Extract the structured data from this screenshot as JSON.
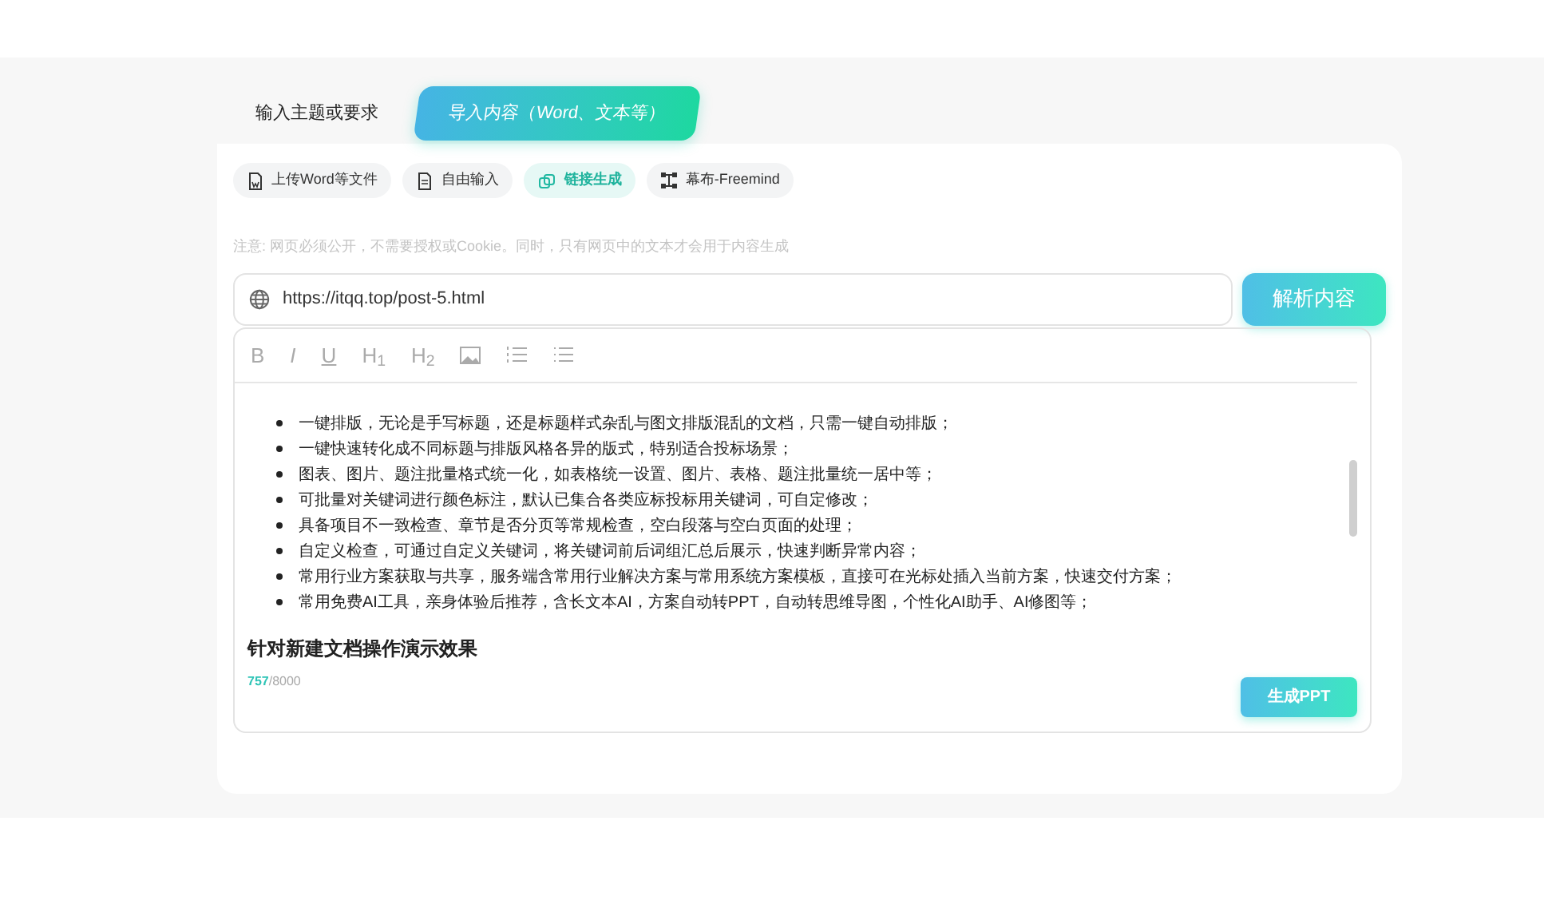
{
  "tabs": [
    {
      "label": "输入主题或要求",
      "selected": false
    },
    {
      "label": "导入内容（Word、文本等）",
      "selected": true
    }
  ],
  "modes": [
    {
      "label": "上传Word等文件",
      "kind": "word",
      "selected": false
    },
    {
      "label": "自由输入",
      "kind": "doc",
      "selected": false
    },
    {
      "label": "链接生成",
      "kind": "link",
      "selected": true
    },
    {
      "label": "幕布-Freemind",
      "kind": "mindmap",
      "selected": false
    }
  ],
  "notice": "注意: 网页必须公开，不需要授权或Cookie。同时，只有网页中的文本才会用于内容生成",
  "url_field": {
    "value": "https://itqq.top/post-5.html"
  },
  "parse_button": "解析内容",
  "toolbar": [
    {
      "kind": "text",
      "label": "B"
    },
    {
      "kind": "text",
      "label": "I",
      "italic": true
    },
    {
      "kind": "text",
      "label": "U",
      "underline": true
    },
    {
      "kind": "text",
      "label": "H$_{1}$"
    },
    {
      "kind": "text",
      "label": "H$_{2}$"
    },
    {
      "kind": "image"
    },
    {
      "kind": "ordered-list"
    },
    {
      "kind": "bullet-list"
    }
  ],
  "editor": {
    "bullets": [
      "一键排版，无论是手写标题，还是标题样式杂乱与图文排版混乱的文档，只需一键自动排版；",
      "一键快速转化成不同标题与排版风格各异的版式，特别适合投标场景；",
      "图表、图片、题注批量格式统一化，如表格统一设置、图片、表格、题注批量统一居中等；",
      "可批量对关键词进行颜色标注，默认已集合各类应标投标用关键词，可自定修改；",
      "具备项目不一致检查、章节是否分页等常规检查，空白段落与空白页面的处理；",
      "自定义检查，可通过自定义关键词，将关键词前后词组汇总后展示，快速判断异常内容；",
      "常用行业方案获取与共享，服务端含常用行业解决方案与常用系统方案模板，直接可在光标处插入当前方案，快速交付方案；",
      "常用免费AI工具，亲身体验后推荐，含长文本AI，方案自动转PPT，自动转思维导图，个性化AI助手、AI修图等；"
    ],
    "heading": "针对新建文档操作演示效果",
    "count": "757",
    "limit": "/8000"
  },
  "generate_button": "生成PPT"
}
